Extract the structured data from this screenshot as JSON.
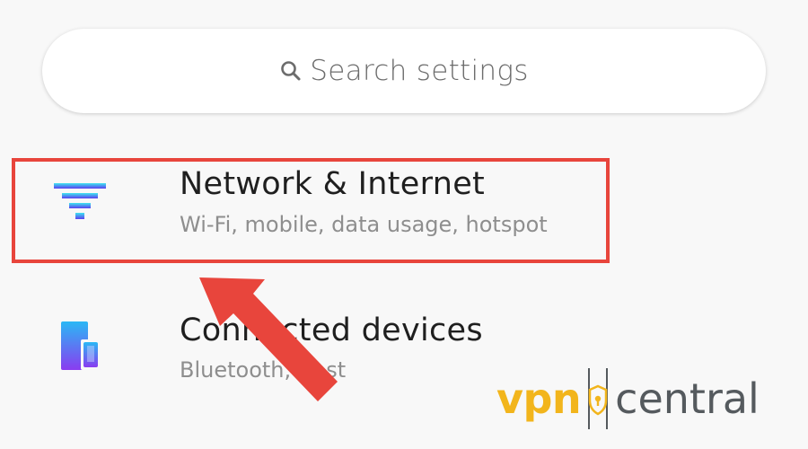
{
  "search": {
    "placeholder": "Search settings",
    "icon": "search-icon"
  },
  "settings_items": [
    {
      "title": "Network & Internet",
      "subtitle": "Wi-Fi, mobile, data usage, hotspot",
      "icon": "network-icon",
      "highlighted": true
    },
    {
      "title": "Connected devices",
      "subtitle": "Bluetooth, Cast",
      "icon": "connected-devices-icon",
      "highlighted": false
    }
  ],
  "annotation": {
    "highlight_color": "#e8453c",
    "arrow_color": "#e8453c"
  },
  "watermark": {
    "brand_part1": "vpn",
    "brand_part2": "central",
    "color_part1": "#f2b51c",
    "color_part2": "#555a5e"
  },
  "colors": {
    "background": "#f8f8f8",
    "title_text": "#1f1f1f",
    "subtitle_text": "#8e8e8e",
    "network_icon_top": "#3ee6f0",
    "network_icon_bottom": "#5b3ff0",
    "devices_icon_top": "#2ab8f5",
    "devices_icon_bottom": "#8a3cf0"
  }
}
